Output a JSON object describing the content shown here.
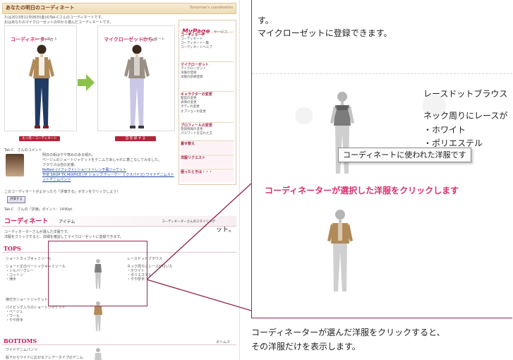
{
  "page": {
    "header_title": "あなたの明日のコーディネート",
    "header_sub": "Tomorrow's coordination",
    "intro_line1": "たは2013年12月06日(金)のTak-Cさんのコーディネートです。",
    "intro_line2": "おはあなたのマイクローゼットの中から選んだコーディネートです。",
    "panel_left_title": "コーディネーター",
    "panel_left_title2": "の",
    "panel_left_sub": "コーディネート",
    "panel_right_title": "マイクローゼットから",
    "panel_right_title2": "の",
    "panel_right_sub": "コーディネート",
    "btn_left": "もっ見ーコーディネート",
    "btn_right": "自 登 録 す る",
    "comment_name": "Tak-C　さんのコメント",
    "comment_line1": "明日の街はやや寒めのある晴れ。",
    "comment_line2": "ベージュのショートジャケットをデニムであしゃれに着こなしてみました。",
    "comment_line3": "ブラウスは自の定番。",
    "comment_link1": "Reflect (リフレクト) ショートトレンチ風ジャケット",
    "comment_link2": "THE SHOP TK MIXPICE (ザ ショップ ティーケー ミクスパイス) ワイドデニムスト",
    "comment_link3": "ットデニムパンツ",
    "like_line": "このコーディネートがよかったら「評価する」ボタンをクリックしよう!",
    "like_button": "評価する",
    "points_line": "Tak-C　さんの「評価」ポイント：2490pt",
    "items_title": "コーディネート",
    "items_title_suffix": "アイテム",
    "items_right": "コーディネーターさんのスタイリング",
    "items_desc1": "コーディネーターさんが選んだ洋服です。",
    "items_desc2": "洋服をクリックすると、詳細を確認してマイクローゼットに登録できます。",
    "tops_label": "TOPS",
    "bottoms_label": "BOTTOMS",
    "bottoms_right": "ボトムス",
    "tops_item1_name": "ショートカップキャミソール",
    "tops_item1_detail": [
      "ショート丈のベーシックキャミソール",
      "・シルバーグレー",
      "・コットン",
      "・薄手"
    ],
    "tops_item2_name": "レースドットブラウス",
    "tops_item2_detail": [
      "ネック周りにレースが付いた",
      "・ホワイト",
      "・ポリエステル",
      "・やや厚手"
    ],
    "tops_item3_name": "襟付きショートジャケット",
    "tops_item3_detail": [
      "パイピング入りのショートジャケット",
      "・ベージュ",
      "・ウール",
      "・やや厚手"
    ],
    "bottoms_item1_name": "ワイドデニムパンツ",
    "bottoms_item1_detail": [
      "股下からワイドに広がるフレアータイプのデニム"
    ],
    "stray_text": "ット。"
  },
  "mypage": {
    "title": "MyPage",
    "title_sub": "サービス",
    "sections": [
      {
        "head": "コーディネート",
        "items": [
          "コーディネート",
          "コーディネート一覧",
          "コーディネートヘルプ"
        ]
      },
      {
        "head": "マイクローゼット",
        "items": [
          "マイクローゼット",
          "洋服の登録",
          "洋服の新規登録"
        ]
      },
      {
        "head": "キャラクターの変更",
        "items": [
          "髪型の変更",
          "表情の変更",
          "ボディの変更",
          "オプションの変更"
        ]
      },
      {
        "head": "プロフィールの変更",
        "items": [
          "登録情報の変更",
          "パスワードを忘れた方"
        ]
      }
    ],
    "promo1": "着せ替え",
    "promo2": "洋服リクエスト",
    "promo3": "困ったときは・・・"
  },
  "zoom": {
    "top_line1": "す。",
    "top_line2": "マイクローゼットに登録できます。",
    "item_name": "レースドットブラウス",
    "detail_line1": "ネック周りにレースが",
    "detail_line2": "・ホワイト",
    "detail_line3": "・ポリエステル",
    "tooltip": "コーディネートに使われた洋服です",
    "headline": "コーディネーターが選択した洋服をクリックします"
  },
  "caption": {
    "line1": "コーディネーターが選んだ洋服をクリックすると、",
    "line2": "その洋服だけを表示します。"
  },
  "colors": {
    "accent": "#d8306f",
    "highlight_border": "#8e2a52",
    "arrow_green": "#8bc34a",
    "button_red": "#b3243a"
  }
}
